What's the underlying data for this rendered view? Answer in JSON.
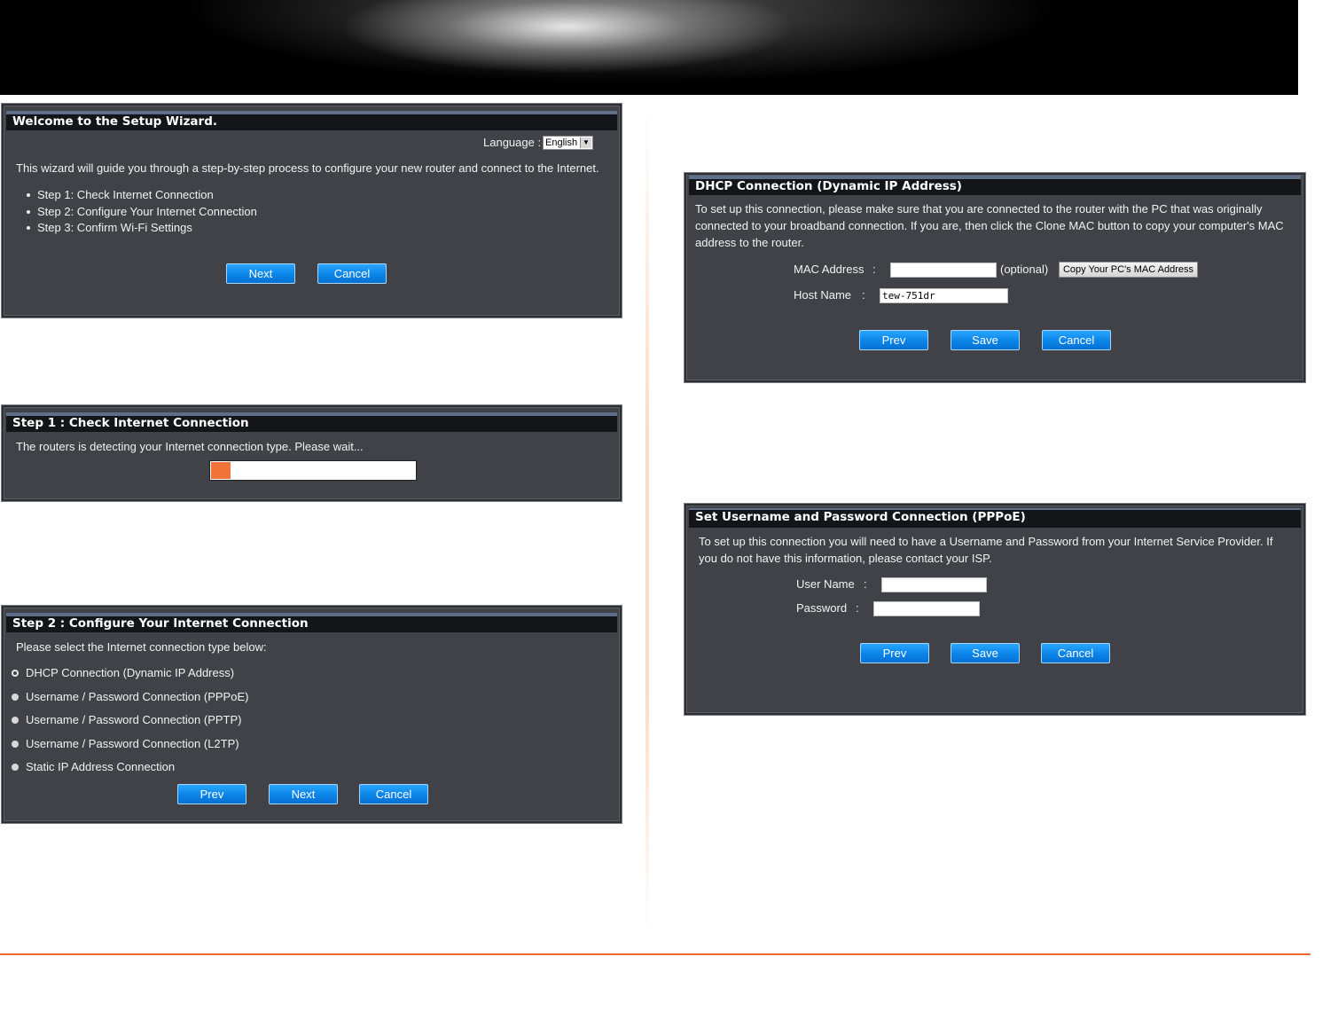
{
  "wizard": {
    "title": "Welcome to the Setup Wizard.",
    "language_label": "Language :",
    "language_value": "English",
    "description": "This wizard will guide you through a step-by-step process to configure your new router and connect to the Internet.",
    "steps": [
      "Step 1: Check Internet Connection",
      "Step 2: Configure Your Internet Connection",
      "Step 3: Confirm Wi-Fi Settings"
    ],
    "next_label": "Next",
    "cancel_label": "Cancel"
  },
  "step1": {
    "title": "Step 1 : Check Internet Connection",
    "message": "The routers is detecting your Internet connection type. Please wait...",
    "progress": 0.1
  },
  "step2": {
    "title": "Step 2 : Configure Your Internet Connection",
    "prompt": "Please select the Internet connection type below:",
    "options": [
      {
        "label": "DHCP Connection (Dynamic IP Address)",
        "selected": true
      },
      {
        "label": "Username / Password Connection (PPPoE)",
        "selected": false
      },
      {
        "label": "Username / Password Connection (PPTP)",
        "selected": false
      },
      {
        "label": "Username / Password Connection (L2TP)",
        "selected": false
      },
      {
        "label": "Static IP Address Connection",
        "selected": false
      }
    ],
    "prev_label": "Prev",
    "next_label": "Next",
    "cancel_label": "Cancel"
  },
  "dhcp": {
    "title": "DHCP Connection (Dynamic IP Address)",
    "description_lines": [
      "To set up this connection, please make sure that you are connected to the router with the PC that was originally",
      "connected to your broadband connection. If you are, then click the Clone MAC button to copy your computer's MAC",
      "address to the router."
    ],
    "mac_label": "MAC Address",
    "colon": ":",
    "mac_value": "",
    "optional_text": "(optional)",
    "copy_mac_label": "Copy Your PC's MAC Address",
    "host_label": "Host Name",
    "host_value": "tew-751dr",
    "prev_label": "Prev",
    "save_label": "Save",
    "cancel_label": "Cancel"
  },
  "pppoe": {
    "title": "Set Username and Password Connection (PPPoE)",
    "description_lines": [
      "To set up this connection you will need to have a Username and Password from your Internet Service Provider. If",
      "you do not have this information, please contact your ISP."
    ],
    "username_label": "User Name",
    "password_label": "Password",
    "colon": ":",
    "username_value": "",
    "password_value": "",
    "prev_label": "Prev",
    "save_label": "Save",
    "cancel_label": "Cancel"
  },
  "colors": {
    "panel_bg": "#404247",
    "title_bar": "#141519",
    "button_blue": "#0a83e8",
    "progress_orange": "#f0743a",
    "accent_line": "#ee6a2a"
  }
}
